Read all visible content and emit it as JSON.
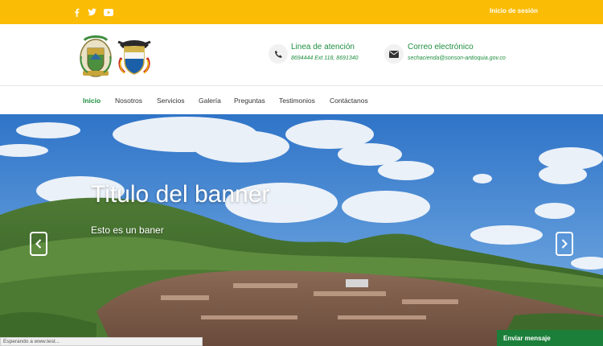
{
  "topbar": {
    "social": [
      "facebook-icon",
      "twitter-icon",
      "youtube-icon"
    ],
    "login_label": "Inicio de sesión",
    "color": "#fbbc05"
  },
  "header": {
    "logos": [
      "municipal-coat-of-arms",
      "colombia-coat-of-arms"
    ],
    "phone": {
      "icon": "phone-icon",
      "title": "Linea de atención",
      "detail": "8694444 Ext 118, 8691340"
    },
    "email": {
      "icon": "envelope-icon",
      "title": "Correo electrónico",
      "detail": "sechacienda@sonson-antioquia.gov.co"
    }
  },
  "nav": {
    "items": [
      "Inicio",
      "Nosotros",
      "Servicios",
      "Galería",
      "Preguntas",
      "Testimonios",
      "Contáctanos"
    ],
    "active": "Inicio",
    "accent": "#1e8e3e"
  },
  "banner": {
    "title": "Titulo del banner",
    "subtitle": "Esto es un baner",
    "prev_icon": "chevron-left-icon",
    "next_icon": "chevron-right-icon"
  },
  "status_text": "Esperando a www.test...",
  "send_message_label": "Enviar mensaje"
}
